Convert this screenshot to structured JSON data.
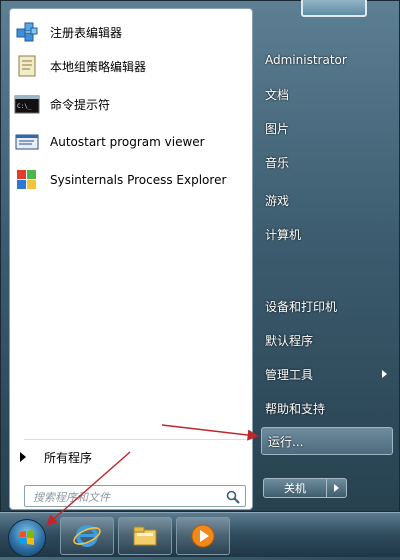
{
  "pinned": [
    {
      "label": "注册表编辑器",
      "icon": "registry-editor-icon"
    },
    {
      "label": "本地组策略编辑器",
      "icon": "policy-editor-icon"
    },
    {
      "label": "命令提示符",
      "icon": "cmd-icon"
    },
    {
      "label": "Autostart program viewer",
      "icon": "autoruns-icon"
    },
    {
      "label": "Sysinternals Process Explorer",
      "icon": "process-explorer-icon"
    }
  ],
  "all_programs": "所有程序",
  "search": {
    "placeholder": "搜索程序和文件"
  },
  "right": {
    "user": "Administrator",
    "items": [
      "文档",
      "图片",
      "音乐",
      "游戏",
      "计算机",
      "设备和打印机",
      "默认程序",
      "管理工具",
      "帮助和支持"
    ],
    "run": "运行..."
  },
  "shutdown": "关机",
  "taskbar": [
    "start-orb",
    "internet-explorer-icon",
    "windows-explorer-icon",
    "media-player-icon"
  ],
  "colors": {
    "annotation": "#c0262b",
    "menu_dark": "#27414f",
    "pane": "#ffffff"
  }
}
